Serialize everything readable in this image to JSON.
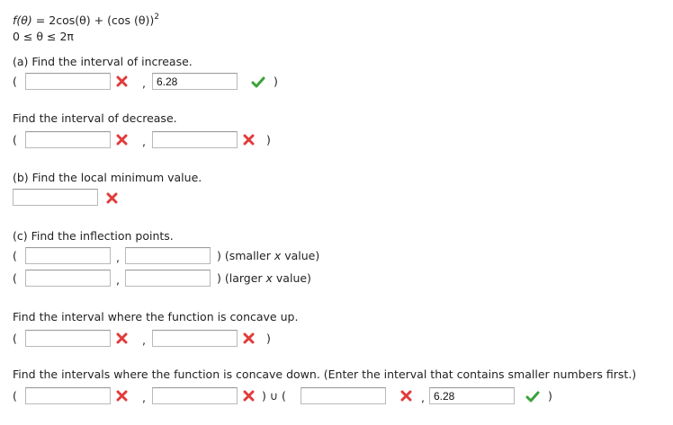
{
  "function": {
    "lhs": "f(θ)",
    "eq": "=",
    "rhs": "2cos(θ) + (cos (θ))",
    "exponent": "2",
    "domain": "0 ≤ θ ≤ 2π"
  },
  "part_a": {
    "increase_label": "(a) Find the interval of increase.",
    "increase_left": "",
    "increase_right": "6.28",
    "decrease_label": "Find the interval of decrease.",
    "decrease_left": "",
    "decrease_right": ""
  },
  "part_b": {
    "label": "(b) Find the local minimum value.",
    "value": ""
  },
  "part_c": {
    "label": "(c) Find the inflection points.",
    "smaller_note_open": ") (smaller ",
    "smaller_note_var": "x",
    "smaller_note_close": " value)",
    "larger_note_open": ") (larger ",
    "larger_note_var": "x",
    "larger_note_close": " value)",
    "p1_x": "",
    "p1_y": "",
    "p2_x": "",
    "p2_y": "",
    "concave_up_label": "Find the interval where the function is concave up.",
    "up_left": "",
    "up_right": "",
    "concave_down_label": "Find the intervals where the function is concave down. (Enter the interval that contains smaller numbers first.)",
    "down1_left": "",
    "down1_right": "",
    "union": ") ∪ (",
    "down2_left": "",
    "down2_right": "6.28"
  },
  "symbols": {
    "open_paren": "(",
    "close_paren": ")",
    "comma": ","
  },
  "icons": {
    "wrong": "x-mark-icon",
    "correct": "check-mark-icon"
  },
  "colors": {
    "wrong": "#e23b3b",
    "correct": "#3aa33a"
  }
}
